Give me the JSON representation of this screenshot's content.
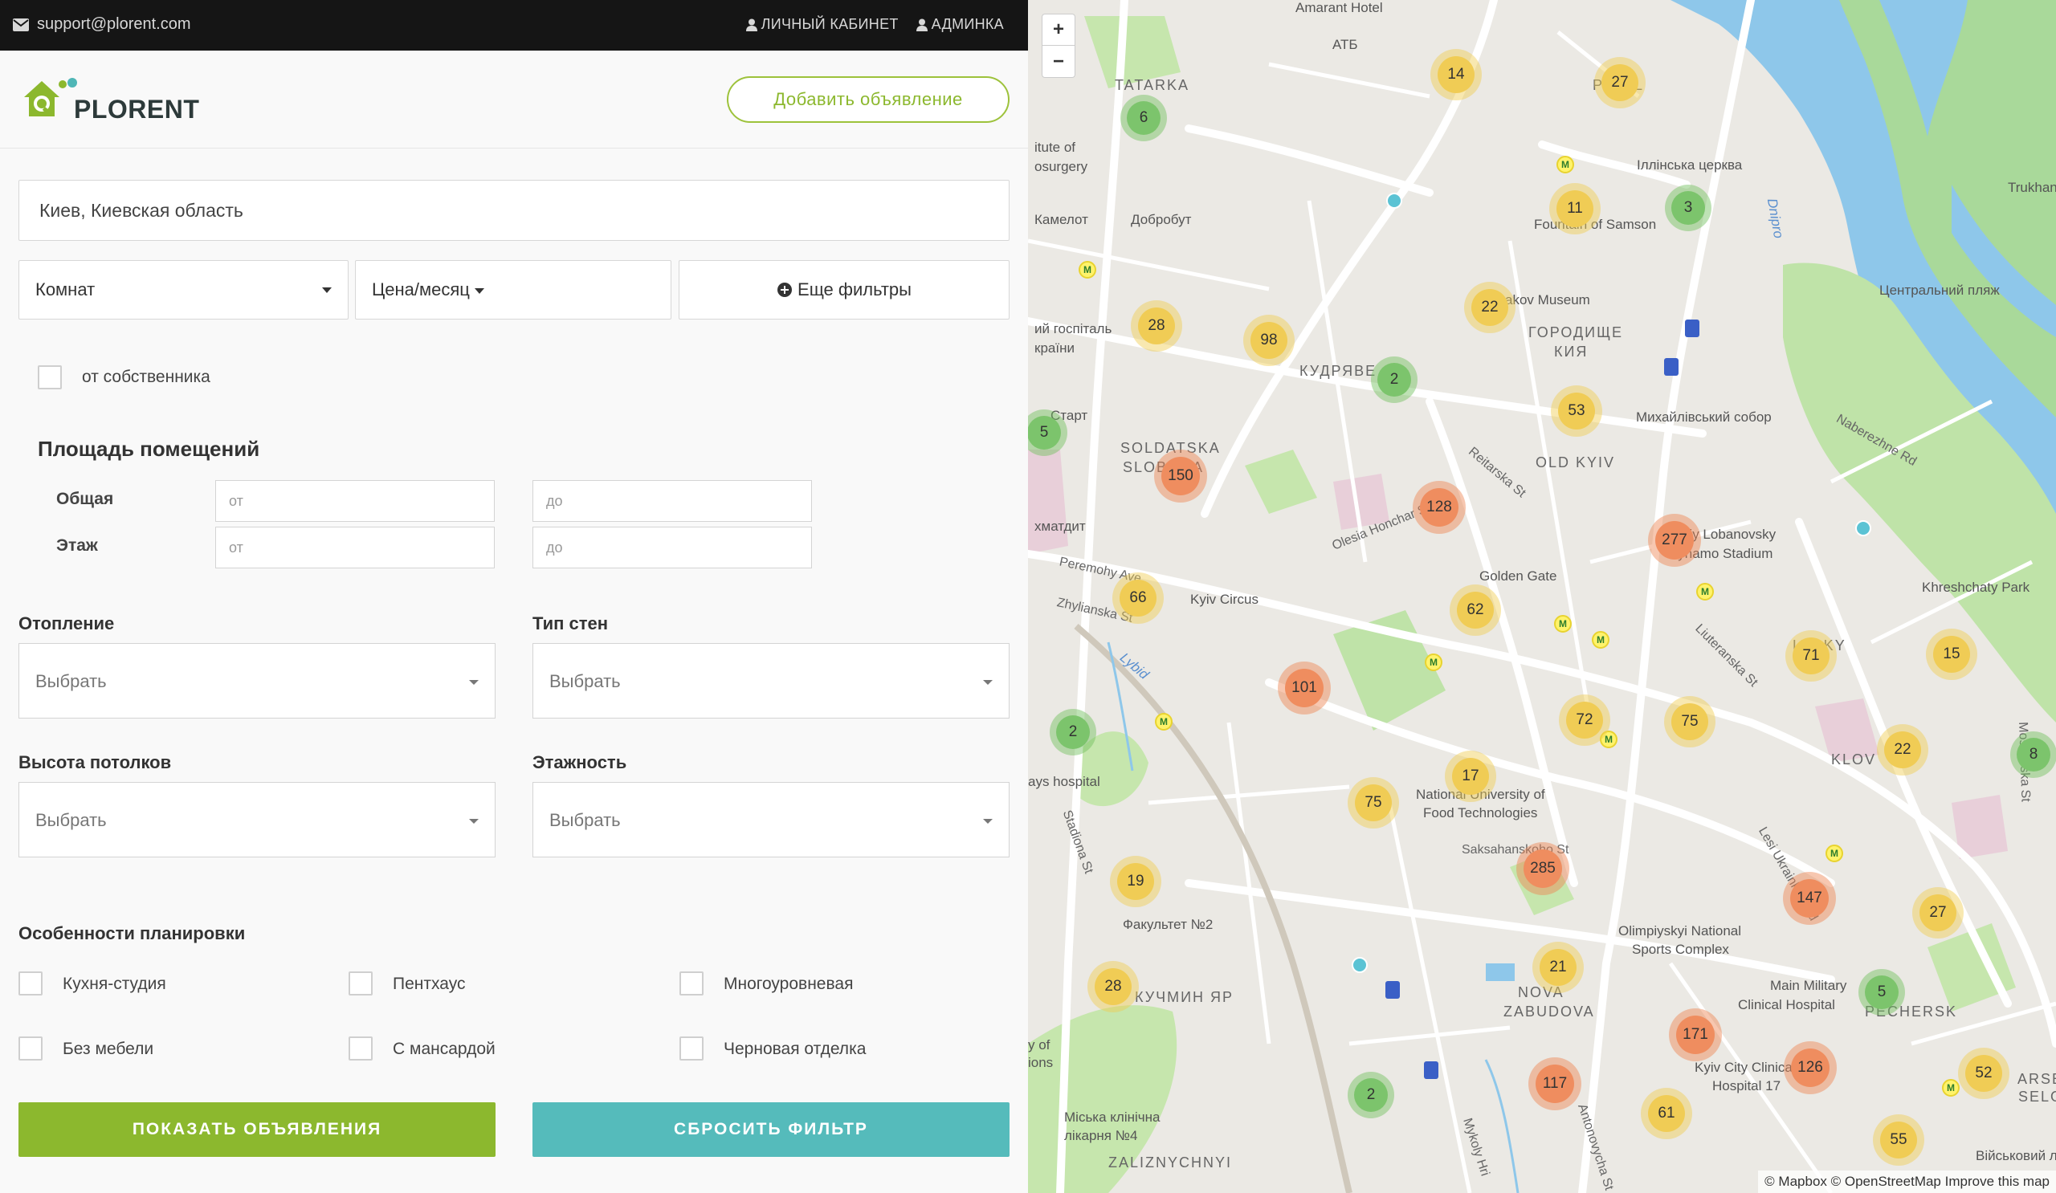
{
  "topbar": {
    "email": "support@plorent.com",
    "cabinet": "ЛИЧНЫЙ КАБИНЕТ",
    "admin": "АДМИНКА"
  },
  "header": {
    "logo_text": "PLORENT",
    "add_button": "Добавить объявление"
  },
  "filters": {
    "location": "Киев, Киевская область",
    "rooms": "Комнат",
    "price": "Цена/месяц",
    "more": "Еще фильтры",
    "owner_checkbox": "от собственника",
    "area_title": "Площадь помещений",
    "total_label": "Общая",
    "floor_label": "Этаж",
    "from_placeholder": "от",
    "to_placeholder": "до",
    "heating_label": "Отопление",
    "walls_label": "Тип стен",
    "ceiling_label": "Высота потолков",
    "floors_label": "Этажность",
    "select_placeholder": "Выбрать",
    "layout_title": "Особенности планировки",
    "layout_options": [
      "Кухня-студия",
      "Пентхаус",
      "Многоуровневая",
      "Без мебели",
      "С мансардой",
      "Черновая отделка"
    ],
    "show_button": "ПОКАЗАТЬ ОБЪЯВЛЕНИЯ",
    "reset_button": "СБРОСИТЬ ФИЛЬТР"
  },
  "map": {
    "zoom_in": "+",
    "zoom_out": "−",
    "attribution": "© Mapbox © OpenStreetMap Improve this map",
    "clusters": [
      {
        "count": "14",
        "level": "yellow"
      },
      {
        "count": "27",
        "level": "yellow"
      },
      {
        "count": "6",
        "level": "green"
      },
      {
        "count": "11",
        "level": "yellow"
      },
      {
        "count": "3",
        "level": "green"
      },
      {
        "count": "28",
        "level": "yellow"
      },
      {
        "count": "98",
        "level": "yellow"
      },
      {
        "count": "22",
        "level": "yellow"
      },
      {
        "count": "2",
        "level": "green"
      },
      {
        "count": "5",
        "level": "green"
      },
      {
        "count": "53",
        "level": "yellow"
      },
      {
        "count": "150",
        "level": "orange"
      },
      {
        "count": "128",
        "level": "orange"
      },
      {
        "count": "277",
        "level": "orange"
      },
      {
        "count": "66",
        "level": "yellow"
      },
      {
        "count": "62",
        "level": "yellow"
      },
      {
        "count": "71",
        "level": "yellow"
      },
      {
        "count": "15",
        "level": "yellow"
      },
      {
        "count": "101",
        "level": "orange"
      },
      {
        "count": "2",
        "level": "green"
      },
      {
        "count": "72",
        "level": "yellow"
      },
      {
        "count": "75",
        "level": "yellow"
      },
      {
        "count": "22",
        "level": "yellow"
      },
      {
        "count": "8",
        "level": "green"
      },
      {
        "count": "17",
        "level": "yellow"
      },
      {
        "count": "75",
        "level": "yellow"
      },
      {
        "count": "285",
        "level": "orange"
      },
      {
        "count": "19",
        "level": "yellow"
      },
      {
        "count": "147",
        "level": "orange"
      },
      {
        "count": "27",
        "level": "yellow"
      },
      {
        "count": "21",
        "level": "yellow"
      },
      {
        "count": "28",
        "level": "yellow"
      },
      {
        "count": "5",
        "level": "green"
      },
      {
        "count": "171",
        "level": "orange"
      },
      {
        "count": "126",
        "level": "orange"
      },
      {
        "count": "117",
        "level": "orange"
      },
      {
        "count": "2",
        "level": "green"
      },
      {
        "count": "61",
        "level": "yellow"
      },
      {
        "count": "52",
        "level": "yellow"
      },
      {
        "count": "55",
        "level": "yellow"
      }
    ],
    "labels": {
      "amarant": "Amarant Hotel",
      "atb": "АТБ",
      "tatarka": "TATARKA",
      "podil": "PODIL",
      "illinska": "Іллінська церква",
      "trukhan": "Trukhan",
      "institute": "itute of",
      "neurosurgery": "osurgery",
      "dobrobut": "Добробут",
      "kamelot": "Камелот",
      "fountain": "Fountain of Samson",
      "dnipro": "Dnipro",
      "central_beach": "Центральний пляж",
      "hospital_l": "ий госпіталь",
      "ukrainy": "країни",
      "bulgakov": "Bulgakov Museum",
      "horodyshche": "ГОРОДИЩЕ",
      "kiya": "КИЯ",
      "kudriave": "КУДРЯВЕ",
      "start": "Старт",
      "mykhailivskyi": "Михайлівський собор",
      "naberezhne": "Naberezhne Rd",
      "soldatska": "SOLDATSKA",
      "sloboda": "SLOBODA",
      "old_kyiv": "OLD KYIV",
      "reitarska": "Reitarska St",
      "khmatdyt": "хматдит",
      "olesia": "Olesia Honchar St",
      "peremohy": "Peremohy Ave",
      "zhylianska": "Zhylianska St",
      "kyiv_circus": "Kyiv Circus",
      "golden_gate": "Golden Gate",
      "dynamo": "Valeriy Lobanovsky",
      "dynamo2": "Dynamo Stadium",
      "khreshchaty": "Khreshchaty Park",
      "lybid": "Lybid",
      "liuteranska": "Liuteranska St",
      "lypky": "LYPKY",
      "klov": "KLOV",
      "moskovska": "Moskovska St",
      "ays_hospital": "ays hospital",
      "stadiona": "Stadiona St",
      "food_tech": "National University of",
      "food_tech2": "Food Technologies",
      "saksahanskoho": "Saksahanskoho St",
      "lesi": "Lesi Ukrainky Blvd",
      "fakultet": "Факультет №2",
      "olimpiyskyi": "Olimpiyskyi National",
      "olimpiyskyi2": "Sports Complex",
      "kuchmin": "КУЧМИН ЯР",
      "nova": "NOVA",
      "zabudova": "ZABUDOVA",
      "main_military": "Main Military",
      "main_military2": "Clinical Hospital",
      "pechersk": "PECHERSK",
      "of_ions": "y of",
      "ions": "ions",
      "kyiv_city": "Kyiv City Clinical",
      "kyiv_city2": "Hospital 17",
      "selo": "SELO",
      "arsenal": "ARSENAL",
      "miska": "Міська клінічна",
      "likarnia": "лікарня №4",
      "mykoly": "Mykoly Hri",
      "antonovycha": "Antonovycha St",
      "zaliznychnyi": "ZALIZNYCHNYI",
      "viiskovyi": "Військовий лі"
    }
  }
}
